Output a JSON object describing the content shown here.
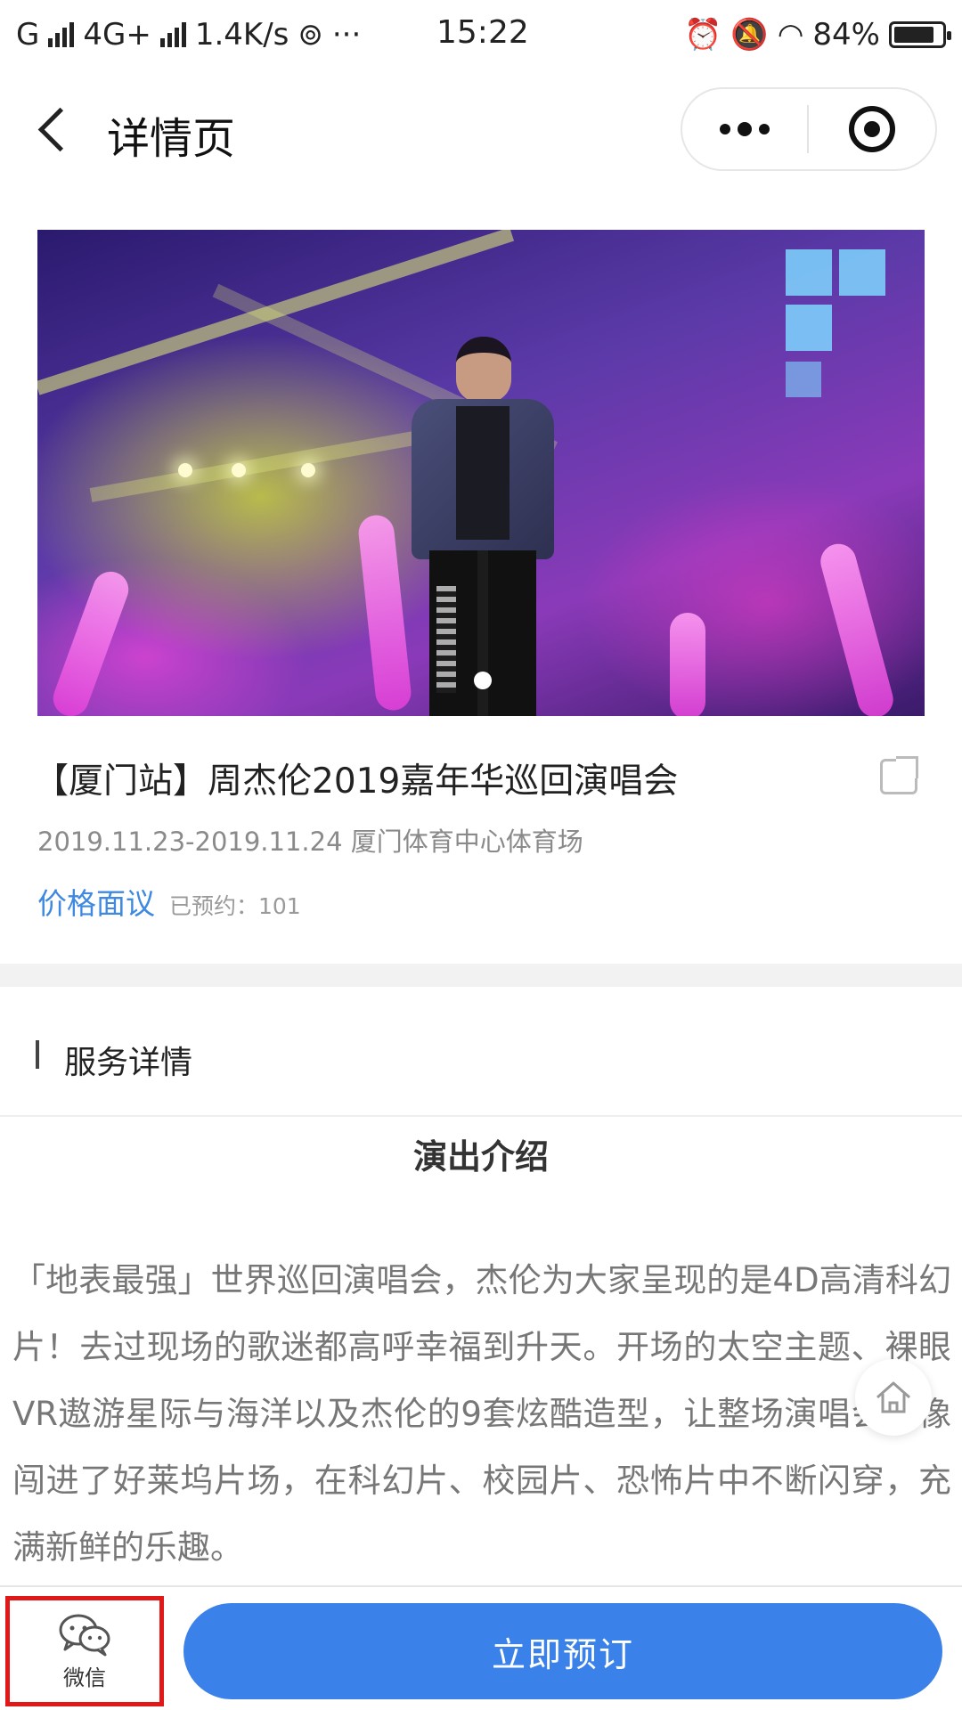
{
  "status_bar": {
    "carrier": "G",
    "network": "4G+",
    "speed": "1.4K/s",
    "more": "···",
    "time": "15:22",
    "battery": "84%",
    "battery_level": 0.84
  },
  "nav": {
    "title": "详情页"
  },
  "banner": {
    "slide_count": 1,
    "active_slide": 1
  },
  "event": {
    "title": "【厦门站】周杰伦2019嘉年华巡回演唱会",
    "dates_venue": "2019.11.23-2019.11.24 厦门体育中心体育场",
    "price": "价格面议",
    "booked": "已预约：101"
  },
  "section": {
    "title": "服务详情"
  },
  "intro": {
    "title": "演出介绍",
    "body": "「地表最强」世界巡回演唱会，杰伦为大家呈现的是4D高清科幻片！去过现场的歌迷都高呼幸福到升天。开场的太空主题、裸眼VR遨游星际与海洋以及杰伦的9套炫酷造型，让整场演唱会就像闯进了好莱坞片场，在科幻片、校园片、恐怖片中不断闪穿，充满新鲜的乐趣。"
  },
  "bottom_bar": {
    "wechat_label": "微信",
    "book_label": "立即预订"
  },
  "colors": {
    "accent": "#3a82ea",
    "price": "#3f8ae0",
    "highlight_box": "#e01818"
  }
}
